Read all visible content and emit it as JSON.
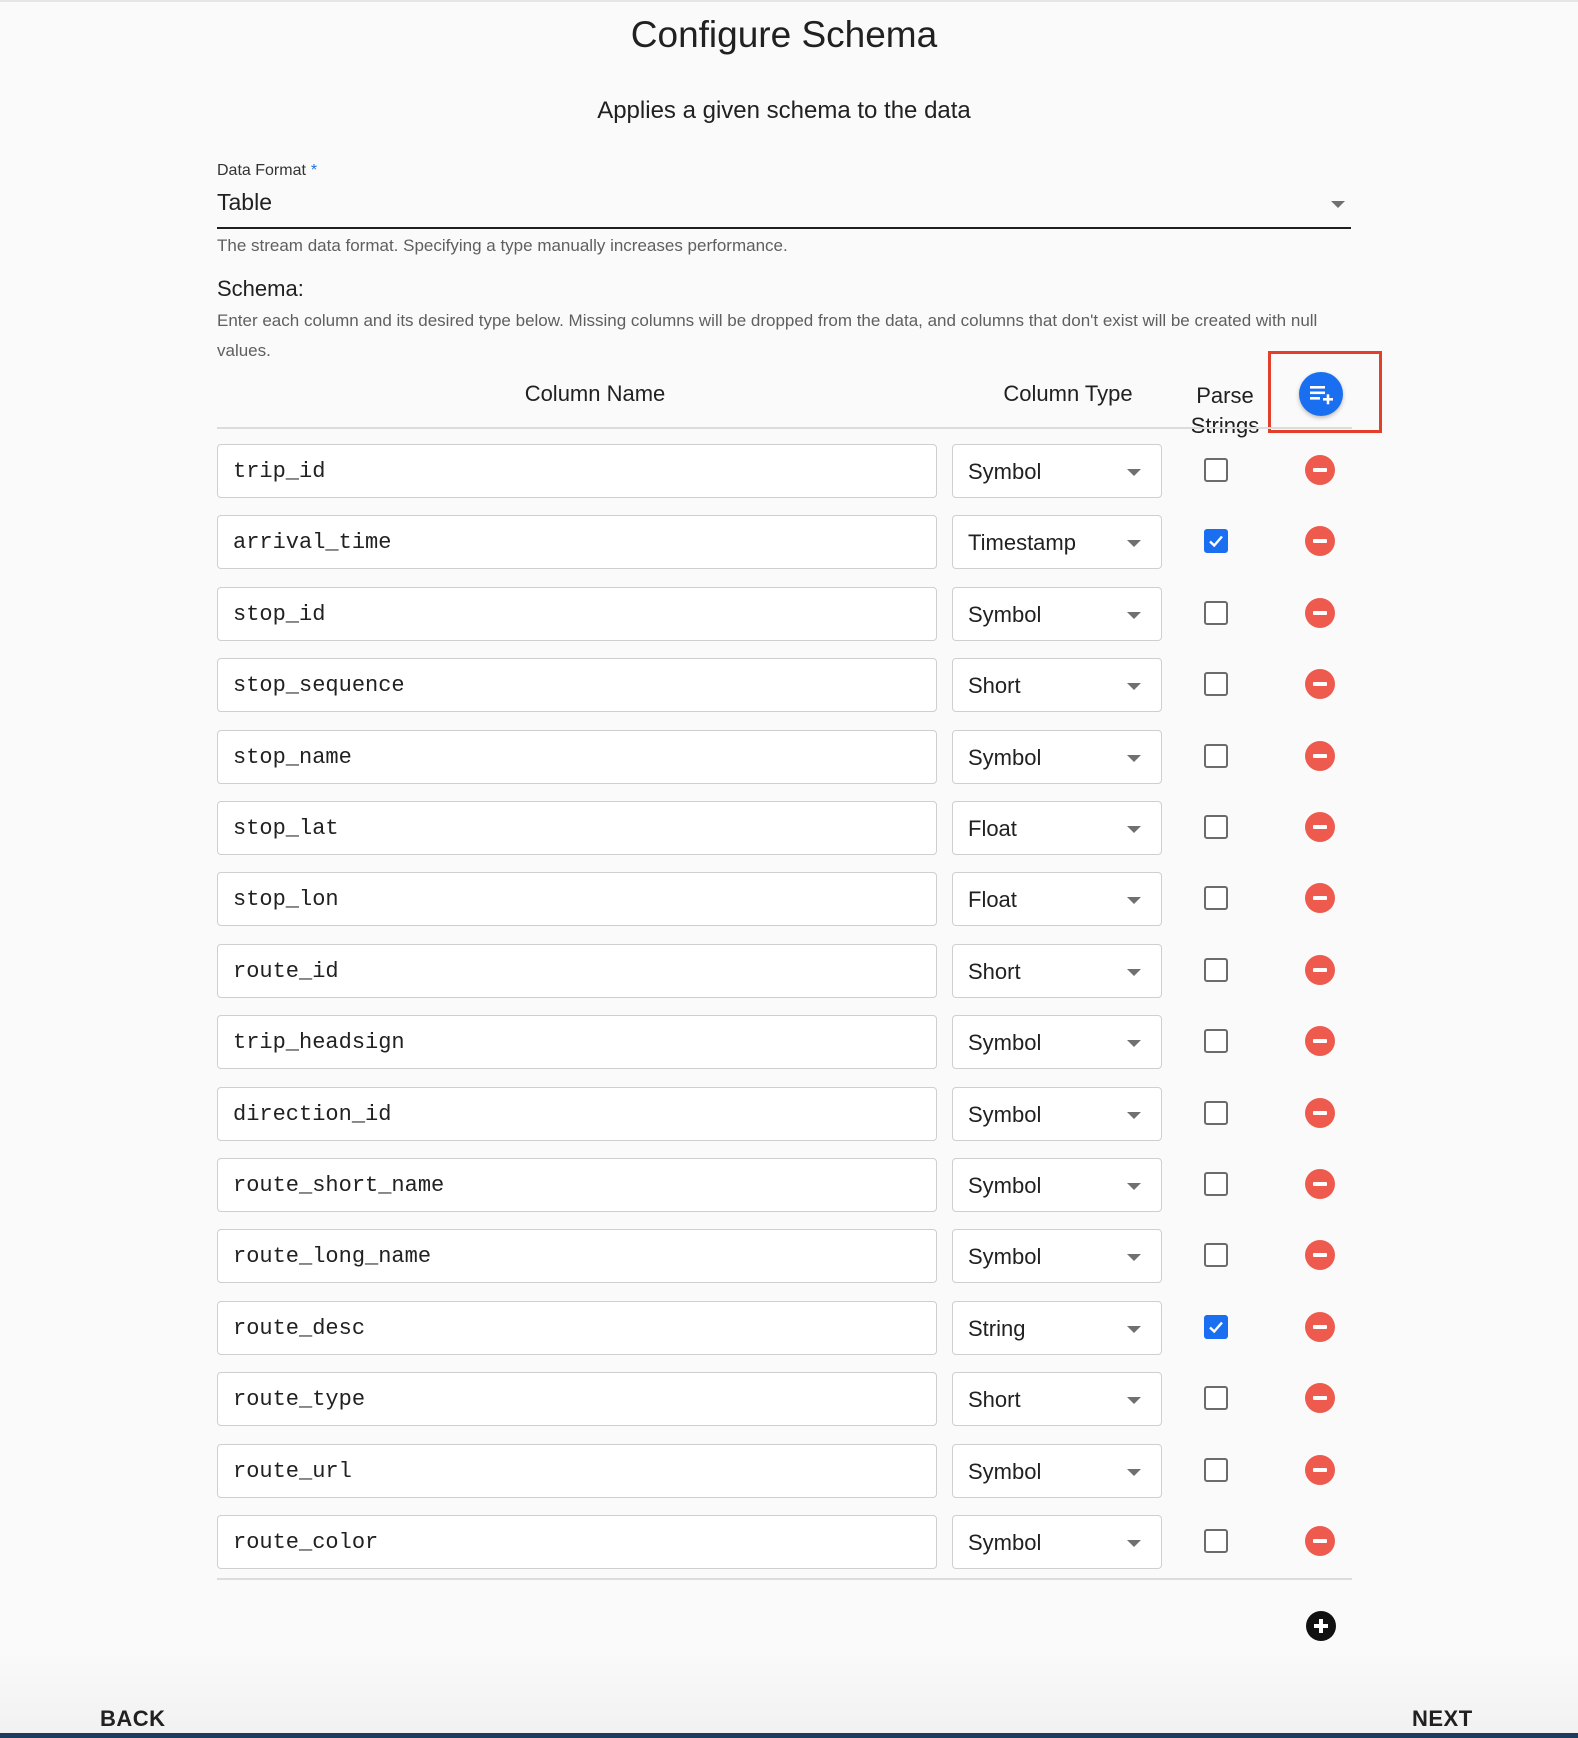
{
  "page": {
    "title": "Configure Schema",
    "subtitle": "Applies a given schema to the data"
  },
  "data_format": {
    "label": "Data Format",
    "required_marker": "*",
    "value": "Table",
    "help": "The stream data format. Specifying a type manually increases performance."
  },
  "schema": {
    "label": "Schema:",
    "description": "Enter each column and its desired type below. Missing columns will be dropped from the data, and columns that don't exist will be created with null values.",
    "headers": {
      "column_name": "Column Name",
      "column_type": "Column Type",
      "parse_strings": "Parse Strings"
    },
    "rows": [
      {
        "name": "trip_id",
        "type": "Symbol",
        "parse": false
      },
      {
        "name": "arrival_time",
        "type": "Timestamp",
        "parse": true
      },
      {
        "name": "stop_id",
        "type": "Symbol",
        "parse": false
      },
      {
        "name": "stop_sequence",
        "type": "Short",
        "parse": false
      },
      {
        "name": "stop_name",
        "type": "Symbol",
        "parse": false
      },
      {
        "name": "stop_lat",
        "type": "Float",
        "parse": false
      },
      {
        "name": "stop_lon",
        "type": "Float",
        "parse": false
      },
      {
        "name": "route_id",
        "type": "Short",
        "parse": false
      },
      {
        "name": "trip_headsign",
        "type": "Symbol",
        "parse": false
      },
      {
        "name": "direction_id",
        "type": "Symbol",
        "parse": false
      },
      {
        "name": "route_short_name",
        "type": "Symbol",
        "parse": false
      },
      {
        "name": "route_long_name",
        "type": "Symbol",
        "parse": false
      },
      {
        "name": "route_desc",
        "type": "String",
        "parse": true
      },
      {
        "name": "route_type",
        "type": "Short",
        "parse": false
      },
      {
        "name": "route_url",
        "type": "Symbol",
        "parse": false
      },
      {
        "name": "route_color",
        "type": "Symbol",
        "parse": false
      }
    ]
  },
  "icons": {
    "add_columns": "playlist-add-icon",
    "remove_row": "remove-circle-icon",
    "add_row": "add-circle-icon",
    "dropdown": "caret-down-icon",
    "check": "checkmark-icon"
  },
  "colors": {
    "primary": "#1a6ff0",
    "danger": "#ee5a4d",
    "highlight": "#e3402c"
  },
  "nav": {
    "back_label": "BACK",
    "next_label": "NEXT"
  }
}
